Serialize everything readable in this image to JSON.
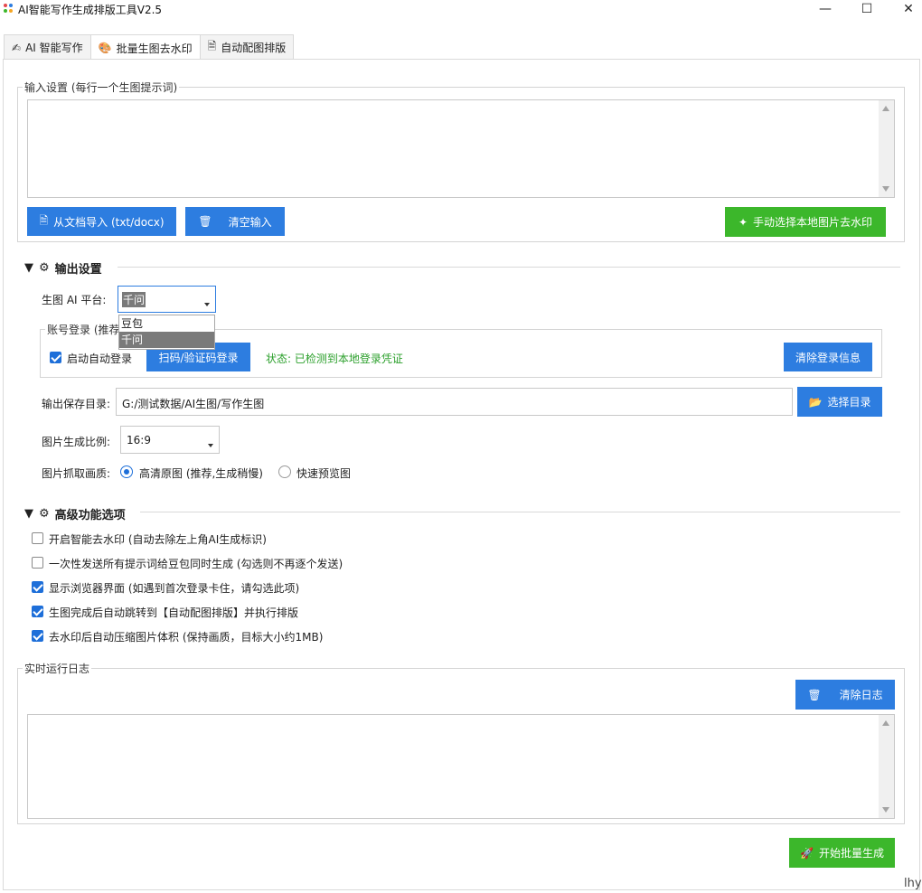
{
  "window": {
    "title": "AI智能写作生成排版工具V2.5",
    "controls": {
      "minimize": "—",
      "maximize": "☐",
      "close": "✕"
    }
  },
  "tabs": [
    {
      "label": "AI 智能写作",
      "icon": "pen-icon"
    },
    {
      "label": "批量生图去水印",
      "icon": "palette-icon"
    },
    {
      "label": "自动配图排版",
      "icon": "document-icon"
    }
  ],
  "input_section": {
    "label": "输入设置 (每行一个生图提示词)",
    "textarea_value": "",
    "import_button": "从文档导入 (txt/docx)",
    "clear_button": "清空输入",
    "manual_watermark_button": "手动选择本地图片去水印"
  },
  "output_section": {
    "title": "输出设置",
    "platform_label": "生图 AI 平台:",
    "platform_value": "千问",
    "platform_options": [
      "豆包",
      "千问"
    ],
    "account_label": "账号登录 (推荐",
    "auto_login_label": "启动自动登录",
    "auto_login_checked": true,
    "scan_login_button": "扫码/验证码登录",
    "status_text": "状态: 已检测到本地登录凭证",
    "clear_login_button": "清除登录信息",
    "save_dir_label": "输出保存目录:",
    "save_dir_value": "G:/测试数据/AI生图/写作生图",
    "choose_dir_button": "选择目录",
    "ratio_label": "图片生成比例:",
    "ratio_value": "16:9",
    "quality_label": "图片抓取画质:",
    "quality_options": [
      {
        "label": "高清原图 (推荐,生成稍慢)",
        "selected": true
      },
      {
        "label": "快速预览图",
        "selected": false
      }
    ]
  },
  "advanced_section": {
    "title": "高级功能选项",
    "options": [
      {
        "label": "开启智能去水印 (自动去除左上角AI生成标识)",
        "checked": false
      },
      {
        "label": "一次性发送所有提示词给豆包同时生成 (勾选则不再逐个发送)",
        "checked": false
      },
      {
        "label": "显示浏览器界面 (如遇到首次登录卡住，请勾选此项)",
        "checked": true
      },
      {
        "label": "生图完成后自动跳转到【自动配图排版】并执行排版",
        "checked": true
      },
      {
        "label": "去水印后自动压缩图片体积 (保持画质，目标大小约1MB)",
        "checked": true
      }
    ]
  },
  "log_section": {
    "label": "实时运行日志",
    "clear_button": "清除日志",
    "log_text": ""
  },
  "start_button": "开始批量生成",
  "corner_text": "lhy",
  "colors": {
    "primary_blue": "#2d7de0",
    "primary_green": "#3cb72b",
    "status_green": "#2ca02c"
  }
}
